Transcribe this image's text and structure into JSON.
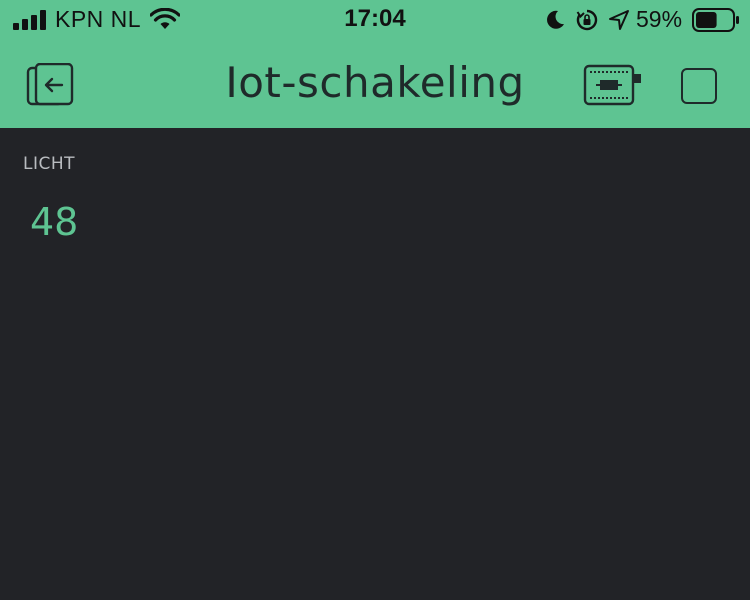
{
  "status_bar": {
    "carrier": "KPN NL",
    "time": "17:04",
    "battery_percent": "59%",
    "battery_level": 0.59,
    "icons": [
      "signal-icon",
      "wifi-icon",
      "moon-icon",
      "rotation-lock-icon",
      "location-arrow-icon",
      "battery-icon"
    ]
  },
  "header": {
    "title": "Iot-schakeling",
    "color": "#5ec492",
    "icons": [
      "exit-icon",
      "device-icon",
      "square-icon"
    ]
  },
  "widget": {
    "label": "LICHT",
    "value": "48",
    "value_color": "#5ec492"
  },
  "colors": {
    "background": "#222327",
    "accent": "#5ec492"
  }
}
